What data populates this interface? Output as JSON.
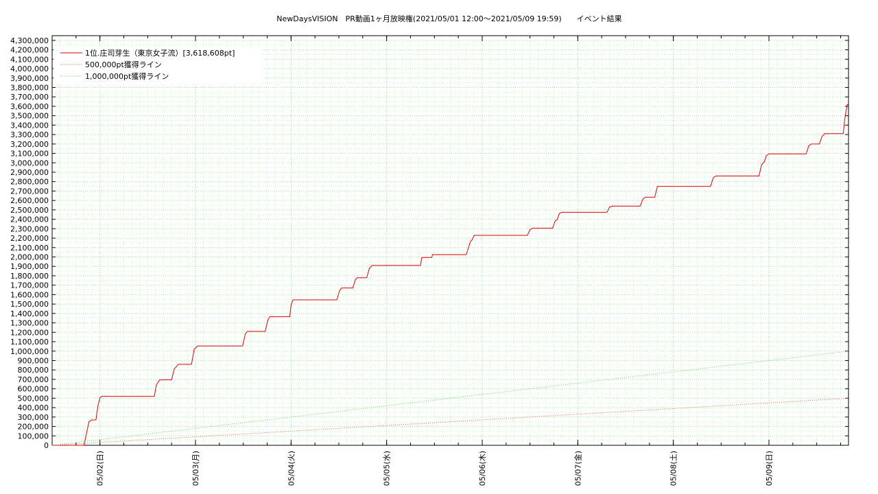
{
  "chart_data": {
    "type": "line",
    "title": "NewDaysVISION　PR動画1ヶ月放映権(2021/05/01 12:00～2021/05/09 19:59)　　イベント結果",
    "xlabel": "",
    "ylabel": "",
    "x_range": [
      "2021-05-01 12:00",
      "2021-05-09 19:59"
    ],
    "ylim": [
      0,
      4350000
    ],
    "y_ticks": [
      0,
      100000,
      200000,
      300000,
      400000,
      500000,
      600000,
      700000,
      800000,
      900000,
      1000000,
      1100000,
      1200000,
      1300000,
      1400000,
      1500000,
      1600000,
      1700000,
      1800000,
      1900000,
      2000000,
      2100000,
      2200000,
      2300000,
      2400000,
      2500000,
      2600000,
      2700000,
      2800000,
      2900000,
      3000000,
      3100000,
      3200000,
      3300000,
      3400000,
      3500000,
      3600000,
      3700000,
      3800000,
      3900000,
      4000000,
      4100000,
      4200000,
      4300000
    ],
    "y_tick_labels": [
      "0",
      "100,000",
      "200,000",
      "300,000",
      "400,000",
      "500,000",
      "600,000",
      "700,000",
      "800,000",
      "900,000",
      "1,000,000",
      "1,100,000",
      "1,200,000",
      "1,300,000",
      "1,400,000",
      "1,500,000",
      "1,600,000",
      "1,700,000",
      "1,800,000",
      "1,900,000",
      "2,000,000",
      "2,100,000",
      "2,200,000",
      "2,300,000",
      "2,400,000",
      "2,500,000",
      "2,600,000",
      "2,700,000",
      "2,800,000",
      "2,900,000",
      "3,000,000",
      "3,100,000",
      "3,200,000",
      "3,300,000",
      "3,400,000",
      "3,500,000",
      "3,600,000",
      "3,700,000",
      "3,800,000",
      "3,900,000",
      "4,000,000",
      "4,100,000",
      "4,200,000",
      "4,300,000"
    ],
    "x_ticks": [
      {
        "x": "2021-05-02 00:00",
        "label": "05/02(日)"
      },
      {
        "x": "2021-05-03 00:00",
        "label": "05/03(月)"
      },
      {
        "x": "2021-05-04 00:00",
        "label": "05/04(火)"
      },
      {
        "x": "2021-05-05 00:00",
        "label": "05/05(水)"
      },
      {
        "x": "2021-05-06 00:00",
        "label": "05/06(木)"
      },
      {
        "x": "2021-05-07 00:00",
        "label": "05/07(金)"
      },
      {
        "x": "2021-05-08 00:00",
        "label": "05/08(土)"
      },
      {
        "x": "2021-05-09 00:00",
        "label": "05/09(日)"
      }
    ],
    "grid": true,
    "legend_position": "top-left",
    "series": [
      {
        "name": "1位.庄司芽生（東京女子流）[3,618,608pt]",
        "color": "#dd0000",
        "style": "solid",
        "points": [
          [
            "2021-05-01 12:00",
            0
          ],
          [
            "2021-05-01 20:00",
            0
          ],
          [
            "2021-05-01 20:45",
            150000
          ],
          [
            "2021-05-01 21:15",
            250000
          ],
          [
            "2021-05-01 22:00",
            270000
          ],
          [
            "2021-05-01 23:00",
            270000
          ],
          [
            "2021-05-01 23:30",
            420000
          ],
          [
            "2021-05-02 00:00",
            505000
          ],
          [
            "2021-05-02 00:30",
            520000
          ],
          [
            "2021-05-02 13:40",
            520000
          ],
          [
            "2021-05-02 14:10",
            640000
          ],
          [
            "2021-05-02 15:00",
            695000
          ],
          [
            "2021-05-02 18:00",
            695000
          ],
          [
            "2021-05-02 18:40",
            810000
          ],
          [
            "2021-05-02 19:40",
            860000
          ],
          [
            "2021-05-02 23:00",
            860000
          ],
          [
            "2021-05-02 23:40",
            1020000
          ],
          [
            "2021-05-03 00:30",
            1055000
          ],
          [
            "2021-05-03 11:50",
            1055000
          ],
          [
            "2021-05-03 12:30",
            1180000
          ],
          [
            "2021-05-03 13:00",
            1210000
          ],
          [
            "2021-05-03 17:30",
            1210000
          ],
          [
            "2021-05-03 18:10",
            1330000
          ],
          [
            "2021-05-03 18:40",
            1365000
          ],
          [
            "2021-05-03 23:40",
            1365000
          ],
          [
            "2021-05-04 00:00",
            1490000
          ],
          [
            "2021-05-04 00:30",
            1545000
          ],
          [
            "2021-05-04 11:30",
            1545000
          ],
          [
            "2021-05-04 12:10",
            1640000
          ],
          [
            "2021-05-04 12:40",
            1670000
          ],
          [
            "2021-05-04 15:30",
            1670000
          ],
          [
            "2021-05-04 16:10",
            1760000
          ],
          [
            "2021-05-04 16:40",
            1780000
          ],
          [
            "2021-05-04 19:00",
            1780000
          ],
          [
            "2021-05-04 19:40",
            1880000
          ],
          [
            "2021-05-04 20:20",
            1910000
          ],
          [
            "2021-05-05 08:30",
            1910000
          ],
          [
            "2021-05-05 08:50",
            1995000
          ],
          [
            "2021-05-05 11:20",
            1995000
          ],
          [
            "2021-05-05 11:30",
            2025000
          ],
          [
            "2021-05-05 20:00",
            2025000
          ],
          [
            "2021-05-05 21:00",
            2160000
          ],
          [
            "2021-05-05 21:30",
            2185000
          ],
          [
            "2021-05-05 22:00",
            2230000
          ],
          [
            "2021-05-06 11:20",
            2230000
          ],
          [
            "2021-05-06 12:00",
            2290000
          ],
          [
            "2021-05-06 12:40",
            2305000
          ],
          [
            "2021-05-06 17:40",
            2305000
          ],
          [
            "2021-05-06 18:20",
            2385000
          ],
          [
            "2021-05-06 18:50",
            2395000
          ],
          [
            "2021-05-06 19:20",
            2460000
          ],
          [
            "2021-05-06 20:00",
            2475000
          ],
          [
            "2021-05-07 07:20",
            2475000
          ],
          [
            "2021-05-07 08:00",
            2530000
          ],
          [
            "2021-05-07 08:40",
            2540000
          ],
          [
            "2021-05-07 15:40",
            2540000
          ],
          [
            "2021-05-07 16:20",
            2615000
          ],
          [
            "2021-05-07 17:00",
            2635000
          ],
          [
            "2021-05-07 19:20",
            2635000
          ],
          [
            "2021-05-07 20:00",
            2750000
          ],
          [
            "2021-05-08 09:20",
            2750000
          ],
          [
            "2021-05-08 10:00",
            2840000
          ],
          [
            "2021-05-08 10:40",
            2860000
          ],
          [
            "2021-05-08 21:30",
            2860000
          ],
          [
            "2021-05-08 22:10",
            2980000
          ],
          [
            "2021-05-08 22:50",
            3010000
          ],
          [
            "2021-05-08 23:20",
            3075000
          ],
          [
            "2021-05-09 00:00",
            3095000
          ],
          [
            "2021-05-09 09:20",
            3095000
          ],
          [
            "2021-05-09 10:00",
            3180000
          ],
          [
            "2021-05-09 10:40",
            3200000
          ],
          [
            "2021-05-09 12:40",
            3200000
          ],
          [
            "2021-05-09 13:20",
            3280000
          ],
          [
            "2021-05-09 14:00",
            3310000
          ],
          [
            "2021-05-09 18:40",
            3310000
          ],
          [
            "2021-05-09 19:00",
            3450000
          ],
          [
            "2021-05-09 19:20",
            3540000
          ],
          [
            "2021-05-09 19:40",
            3618608
          ],
          [
            "2021-05-09 19:59",
            3618608
          ]
        ]
      },
      {
        "name": "500,000pt獲得ライン",
        "color": "#e06040",
        "style": "dotted",
        "points": [
          [
            "2021-05-01 12:00",
            0
          ],
          [
            "2021-05-09 19:59",
            500000
          ]
        ]
      },
      {
        "name": "1,000,000pt獲得ライン",
        "color": "#66cc66",
        "style": "dotted",
        "points": [
          [
            "2021-05-01 12:00",
            0
          ],
          [
            "2021-05-09 19:59",
            1000000
          ]
        ]
      }
    ]
  }
}
